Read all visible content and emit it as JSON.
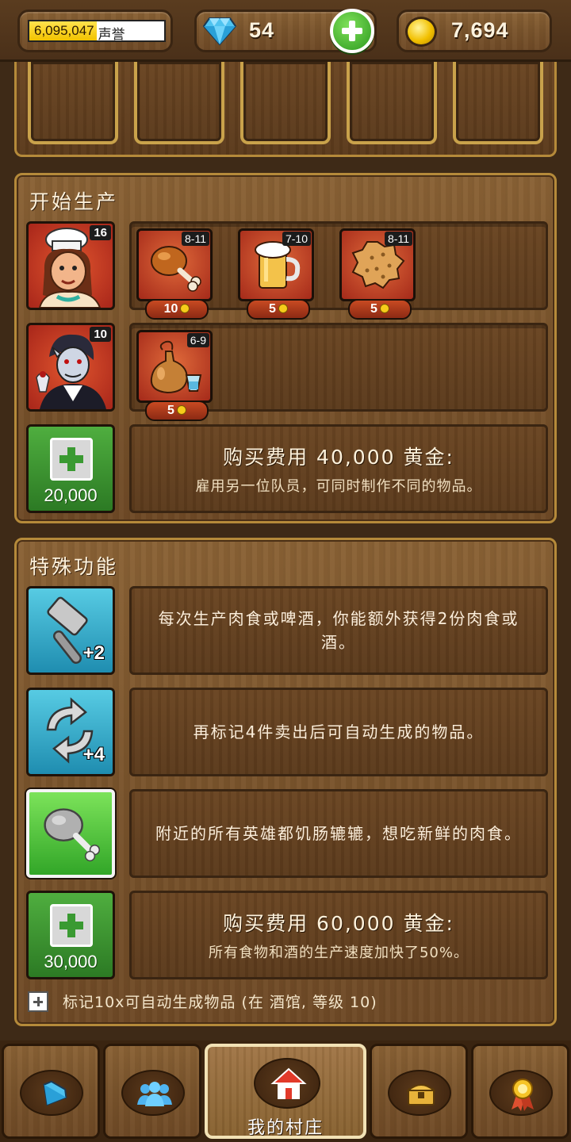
{
  "header": {
    "reputation_value": "6,095,047",
    "reputation_label": "声誉",
    "gems": "54",
    "gold": "7,694"
  },
  "production": {
    "title": "开始生产",
    "workers": [
      {
        "name": "chef",
        "level": "16",
        "items": [
          {
            "icon": "roast-meat-icon",
            "range": "8-11",
            "price": "10"
          },
          {
            "icon": "beer-mug-icon",
            "range": "7-10",
            "price": "5"
          },
          {
            "icon": "cookie-icon",
            "range": "8-11",
            "price": "5"
          }
        ]
      },
      {
        "name": "vampire",
        "level": "10",
        "items": [
          {
            "icon": "wine-flask-icon",
            "range": "6-9",
            "price": "5"
          }
        ]
      }
    ],
    "hire": {
      "price": "20,000",
      "title": "购买费用 40,000 黄金:",
      "subtitle": "雇用另一位队员，可同时制作不同的物品。"
    }
  },
  "special": {
    "title": "特殊功能",
    "features": [
      {
        "icon": "hammer-icon",
        "bonus": "+2",
        "text": "每次生产肉食或啤酒，你能额外获得2份肉食或酒。"
      },
      {
        "icon": "refresh-icon",
        "bonus": "+4",
        "text": "再标记4件卖出后可自动生成的物品。"
      },
      {
        "icon": "meat-icon",
        "bonus": "",
        "text": "附近的所有英雄都饥肠辘辘，想吃新鲜的肉食。"
      }
    ],
    "upgrade": {
      "price": "30,000",
      "title": "购买费用 60,000 黄金:",
      "subtitle": "所有食物和酒的生产速度加快了50%。"
    },
    "footnote": "标记10x可自动生成物品 (在 酒馆, 等级 10)"
  },
  "nav": {
    "village_label": "我的村庄"
  },
  "colors": {
    "gold": "#f2c300",
    "green": "#3a9a32",
    "teal": "#1f8db0",
    "wood": "#7a542c"
  }
}
